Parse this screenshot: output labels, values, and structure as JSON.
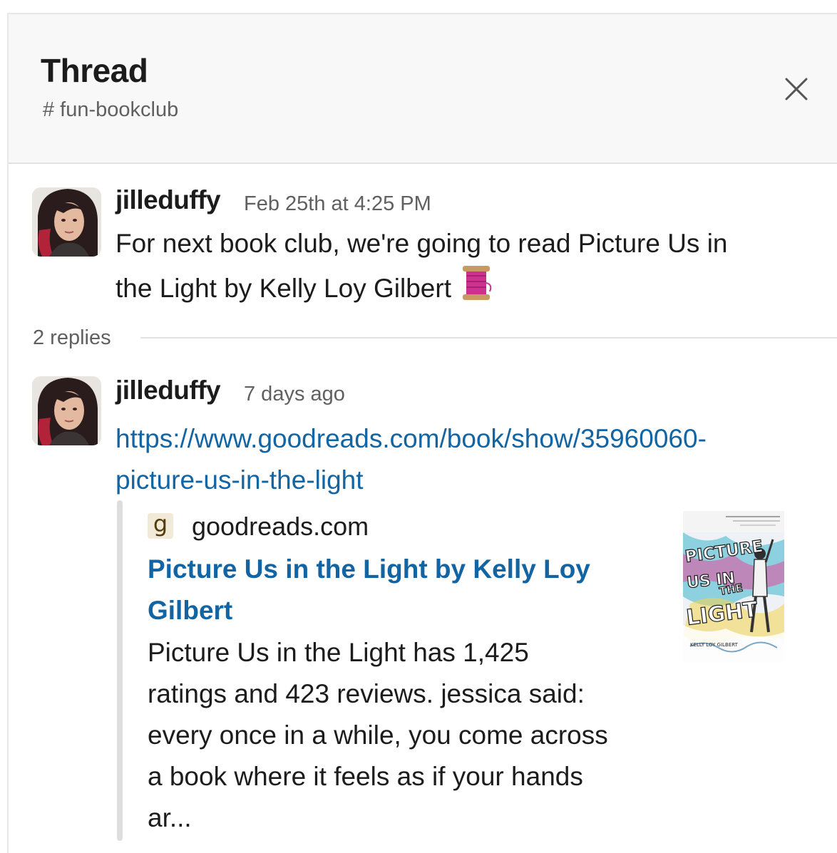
{
  "header": {
    "title": "Thread",
    "channel": "# fun-bookclub",
    "close_icon": "close-icon"
  },
  "parent_message": {
    "author": "jilleduffy",
    "timestamp": "Feb 25th at 4:25 PM",
    "text_line1": "For next book club, we're going to read Picture Us in",
    "text_line2": "the Light by Kelly Loy Gilbert",
    "emoji": "spool-of-thread"
  },
  "replies": {
    "label": "2 replies"
  },
  "reply_message": {
    "author": "jilleduffy",
    "timestamp": "7 days ago",
    "link_line1": "https://www.goodreads.com/book/show/35960060-",
    "link_line2": "picture-us-in-the-light",
    "attachment": {
      "favicon": "g",
      "site": "goodreads.com",
      "title_line1": "Picture Us in the Light by Kelly Loy",
      "title_line2": "Gilbert",
      "desc_lines": [
        "Picture Us in the Light has 1,425",
        "ratings and 423 reviews. jessica said:",
        "every once in a while, you come across",
        "a book where it feels as if your hands",
        "ar..."
      ],
      "cover": {
        "title_line1": "PICTURE",
        "title_line2": "US IN",
        "title_line3": "THE",
        "title_line4": "LIGHT",
        "author": "KELLY LOY GILBERT"
      }
    }
  },
  "colors": {
    "link": "#1264a3",
    "muted": "#616061",
    "header_bg": "#f8f8f8"
  }
}
